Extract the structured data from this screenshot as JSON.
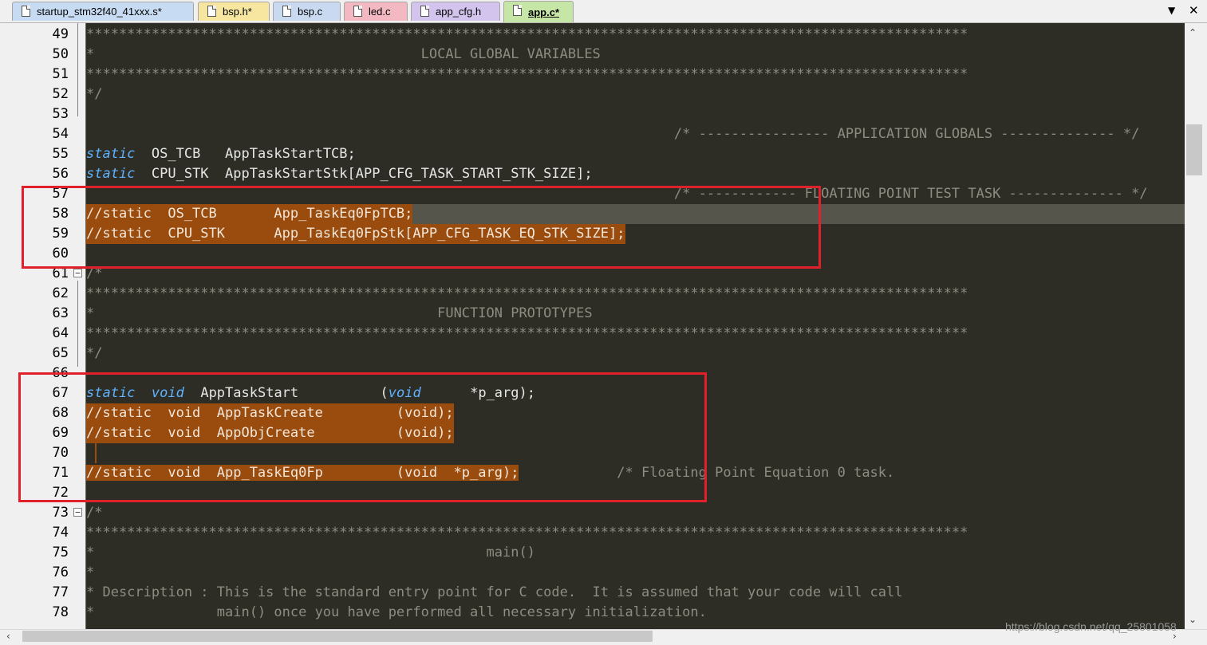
{
  "tabs": [
    {
      "label": "startup_stm32f40_41xxx.s*",
      "color": "#c7dcf2"
    },
    {
      "label": "bsp.h*",
      "color": "#f6e6a0"
    },
    {
      "label": "bsp.c",
      "color": "#c9d9ef"
    },
    {
      "label": "led.c",
      "color": "#f3b9c2"
    },
    {
      "label": "app_cfg.h",
      "color": "#d2c4ec"
    },
    {
      "label": "app.c*",
      "color": "#c5e6a6",
      "active": true
    }
  ],
  "tab_controls": {
    "dropdown": "▼",
    "close": "✕"
  },
  "lines": [
    {
      "n": "49",
      "text": "************************************************************************************************************"
    },
    {
      "n": "50",
      "text": "*                                        LOCAL GLOBAL VARIABLES"
    },
    {
      "n": "51",
      "text": "************************************************************************************************************"
    },
    {
      "n": "52",
      "text": "*/"
    },
    {
      "n": "53",
      "text": ""
    },
    {
      "n": "54",
      "text": "                                                                        /* ---------------- APPLICATION GLOBALS -------------- */"
    },
    {
      "n": "55",
      "text": "static  OS_TCB   AppTaskStartTCB;"
    },
    {
      "n": "56",
      "text": "static  CPU_STK  AppTaskStartStk[APP_CFG_TASK_START_STK_SIZE];"
    },
    {
      "n": "57",
      "text": "                                                                        /* ------------ FLOATING POINT TEST TASK -------------- */"
    },
    {
      "n": "58",
      "text": "//static  OS_TCB       App_TaskEq0FpTCB;"
    },
    {
      "n": "59",
      "text": "//static  CPU_STK      App_TaskEq0FpStk[APP_CFG_TASK_EQ_STK_SIZE];"
    },
    {
      "n": "60",
      "text": ""
    },
    {
      "n": "61",
      "text": "/*"
    },
    {
      "n": "62",
      "text": "************************************************************************************************************"
    },
    {
      "n": "63",
      "text": "*                                          FUNCTION PROTOTYPES"
    },
    {
      "n": "64",
      "text": "************************************************************************************************************"
    },
    {
      "n": "65",
      "text": "*/"
    },
    {
      "n": "66",
      "text": ""
    },
    {
      "n": "67",
      "text": "static  void  AppTaskStart          (void      *p_arg);"
    },
    {
      "n": "68",
      "text": "//static  void  AppTaskCreate         (void);"
    },
    {
      "n": "69",
      "text": "//static  void  AppObjCreate          (void);"
    },
    {
      "n": "70",
      "text": ""
    },
    {
      "n": "71",
      "text": "//static  void  App_TaskEq0Fp         (void  *p_arg);            /* Floating Point Equation 0 task."
    },
    {
      "n": "72",
      "text": ""
    },
    {
      "n": "73",
      "text": "/*"
    },
    {
      "n": "74",
      "text": "************************************************************************************************************"
    },
    {
      "n": "75",
      "text": "*                                                main()"
    },
    {
      "n": "76",
      "text": "*"
    },
    {
      "n": "77",
      "text": "* Description : This is the standard entry point for C code.  It is assumed that your code will call"
    },
    {
      "n": "78",
      "text": "*               main() once you have performed all necessary initialization."
    }
  ],
  "watermark": "https://blog.csdn.net/qq_25801058",
  "colors": {
    "editor_bg": "#2d2d26",
    "comment": "#8c8c80",
    "keyword": "#5fb2ff",
    "selection": "#9a4b0e",
    "annotation_box": "#e0202a"
  }
}
